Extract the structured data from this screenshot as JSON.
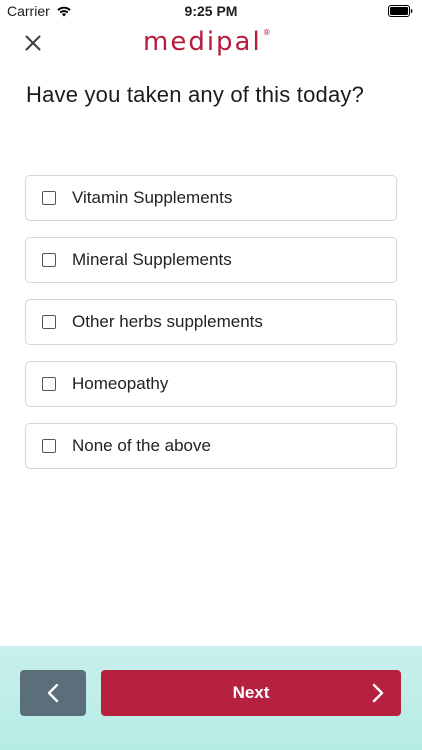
{
  "status_bar": {
    "carrier": "Carrier",
    "time": "9:25 PM",
    "icons": [
      "wifi-icon",
      "battery-icon"
    ]
  },
  "header": {
    "close_icon": "close-icon",
    "logo_text": "medipal",
    "logo_mark": "®"
  },
  "question": "Have you taken any of this today?",
  "options": [
    {
      "label": "Vitamin Supplements",
      "checked": false
    },
    {
      "label": "Mineral Supplements",
      "checked": false
    },
    {
      "label": "Other herbs supplements",
      "checked": false
    },
    {
      "label": "Homeopathy",
      "checked": false
    },
    {
      "label": "None of the above",
      "checked": false
    }
  ],
  "footer": {
    "back_icon": "chevron-left-icon",
    "next_label": "Next",
    "next_icon": "chevron-right-icon"
  },
  "colors": {
    "brand": "#b71c3c",
    "next_button": "#b5213e",
    "back_button": "#5a6f7a",
    "footer_bg": "#c4eeea"
  }
}
